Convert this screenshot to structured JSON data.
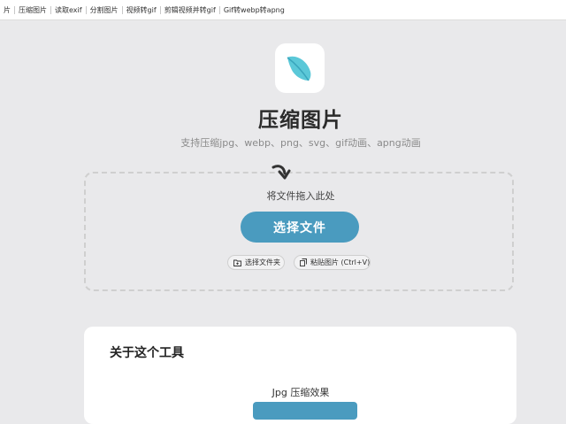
{
  "nav": {
    "items": [
      "片",
      "压缩图片",
      "读取exif",
      "分割图片",
      "视频转gif",
      "剪辑视频并转gif",
      "Gif转webp转apng"
    ]
  },
  "hero": {
    "logo_icon": "feather-leaf-icon",
    "title": "压缩图片",
    "subtitle": "支持压缩jpg、webp、png、svg、gif动画、apng动画"
  },
  "dropzone": {
    "arrow_icon": "curved-arrow-down-icon",
    "text": "将文件拖入此处",
    "select_button": "选择文件",
    "folder_button": "选择文件夹",
    "paste_button": "粘贴图片 (Ctrl+V)"
  },
  "about": {
    "title": "关于这个工具",
    "jpg_heading": "Jpg 压缩效果"
  },
  "colors": {
    "accent": "#4a9bbf",
    "background": "#e9e9eb",
    "leaf": "#5bc8d8"
  }
}
